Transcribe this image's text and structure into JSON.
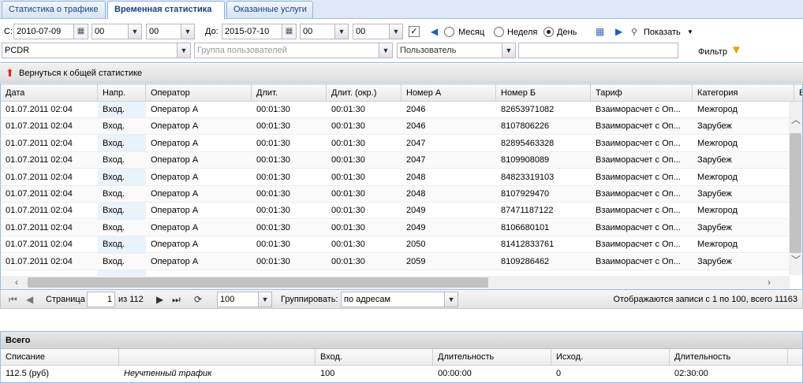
{
  "tabs": [
    "Статистика о трафике",
    "Временная статистика",
    "Оказанные услуги"
  ],
  "filters": {
    "from_label": "С:",
    "from_date": "2010-07-09",
    "from_hour": "00",
    "from_min": "00",
    "to_label": "До:",
    "to_date": "2015-07-10",
    "to_hour": "00",
    "to_min": "00",
    "check_mark": "✓",
    "period_month": "Месяц",
    "period_week": "Неделя",
    "period_day": "День",
    "show_label": "Показать",
    "source": "PCDR",
    "group_placeholder": "Группа пользователей",
    "user_placeholder": "Пользователь",
    "filter_label": "Фильтр"
  },
  "back_link": "Вернуться к общей статистике",
  "grid": {
    "columns": [
      "Дата",
      "Напр.",
      "Оператор",
      "Длит.",
      "Длит. (окр.)",
      "Номер А",
      "Номер Б",
      "Тариф",
      "Категория",
      "Е"
    ],
    "rows": [
      [
        "01.07.2011 02:04",
        "Вход.",
        "Оператор А",
        "00:01:30",
        "00:01:30",
        "2046",
        "82653971082",
        "Взаиморасчет с Оп...",
        "Межгород"
      ],
      [
        "01.07.2011 02:04",
        "Вход.",
        "Оператор А",
        "00:01:30",
        "00:01:30",
        "2046",
        "8107806226",
        "Взаиморасчет с Оп...",
        "Зарубеж"
      ],
      [
        "01.07.2011 02:04",
        "Вход.",
        "Оператор А",
        "00:01:30",
        "00:01:30",
        "2047",
        "82895463328",
        "Взаиморасчет с Оп...",
        "Межгород"
      ],
      [
        "01.07.2011 02:04",
        "Вход.",
        "Оператор А",
        "00:01:30",
        "00:01:30",
        "2047",
        "8109908089",
        "Взаиморасчет с Оп...",
        "Зарубеж"
      ],
      [
        "01.07.2011 02:04",
        "Вход.",
        "Оператор А",
        "00:01:30",
        "00:01:30",
        "2048",
        "84823319103",
        "Взаиморасчет с Оп...",
        "Межгород"
      ],
      [
        "01.07.2011 02:04",
        "Вход.",
        "Оператор А",
        "00:01:30",
        "00:01:30",
        "2048",
        "8107929470",
        "Взаиморасчет с Оп...",
        "Зарубеж"
      ],
      [
        "01.07.2011 02:04",
        "Вход.",
        "Оператор А",
        "00:01:30",
        "00:01:30",
        "2049",
        "87471187122",
        "Взаиморасчет с Оп...",
        "Межгород"
      ],
      [
        "01.07.2011 02:04",
        "Вход.",
        "Оператор А",
        "00:01:30",
        "00:01:30",
        "2049",
        "8106680101",
        "Взаиморасчет с Оп...",
        "Зарубеж"
      ],
      [
        "01.07.2011 02:04",
        "Вход.",
        "Оператор А",
        "00:01:30",
        "00:01:30",
        "2050",
        "81412833761",
        "Взаиморасчет с Оп...",
        "Межгород"
      ],
      [
        "01.07.2011 02:04",
        "Вход.",
        "Оператор А",
        "00:01:30",
        "00:01:30",
        "2059",
        "8109286462",
        "Взаиморасчет с Оп...",
        "Зарубеж"
      ]
    ]
  },
  "pager": {
    "page_label": "Страница",
    "page": "1",
    "of": "из 112",
    "page_size": "100",
    "group_label": "Группировать:",
    "group_value": "по адресам",
    "info": "Отображаются записи с 1 по 100, всего 11163"
  },
  "summary": {
    "title": "Всего",
    "headers": [
      "Списание",
      "",
      "Вход.",
      "Длительность",
      "Исход.",
      "Длительность"
    ],
    "values": [
      "112.5 (руб)",
      "Неучтенный трафик",
      "100",
      "00:00:00",
      "0",
      "02:30:00"
    ]
  }
}
